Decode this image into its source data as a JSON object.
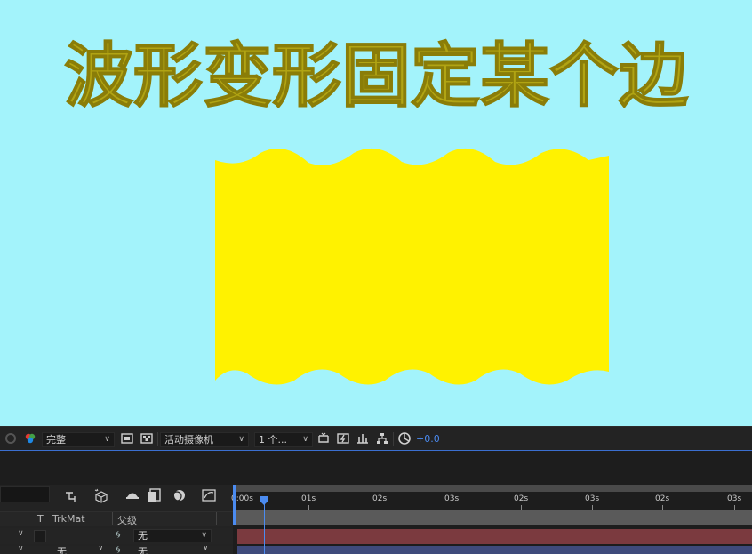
{
  "composition": {
    "headline": "波形变形固定某个边",
    "background_color": "#a3f3fb",
    "shape_color": "#fff200",
    "headline_color": "#b1a413"
  },
  "viewer_toolbar": {
    "resolution": "完整",
    "camera": "活动摄像机",
    "views": "1 个...",
    "exposure": "+0.0",
    "icons": [
      "snapshot-icon",
      "color-channels-icon",
      "toggle-mask-icon",
      "transparency-grid-icon",
      "camera-views-icon",
      "reset-exposure-icon",
      "region-of-interest-icon",
      "fast-preview-icon",
      "3d-view-icon",
      "flowchart-icon",
      "exposure-icon"
    ]
  },
  "timeline": {
    "columns": {
      "t": "T",
      "trkmat": "TrkMat",
      "parent": "父级"
    },
    "layers": [
      {
        "parent": "无"
      },
      {
        "trkmat": "无",
        "parent": "无"
      }
    ],
    "ruler": [
      "0:00s",
      "01s",
      "02s",
      "03s",
      "02s",
      "03s",
      "02s",
      "03s"
    ],
    "accent_color": "#4b8bf0",
    "layer_bar_colors": [
      "#7b3a3f",
      "#3e4a7b"
    ]
  }
}
